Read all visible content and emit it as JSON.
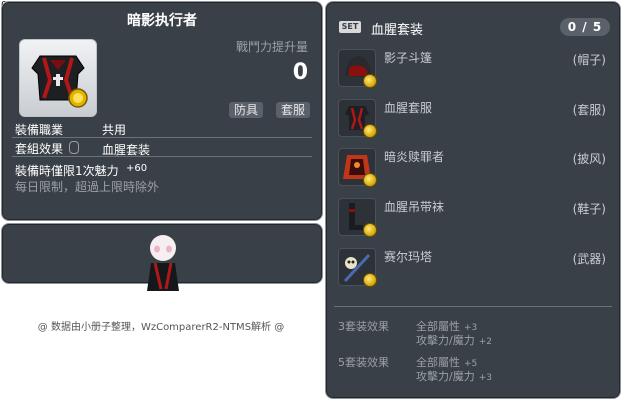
{
  "corner_id": "01052644",
  "item": {
    "title": "暗影执行者",
    "power_label": "戰鬥力提升量",
    "power_value": "0",
    "tags": [
      "防具",
      "套服"
    ],
    "job_label": "裝備職業",
    "job_value": "共用",
    "set_effect_label": "套組效果",
    "set_effect_value": "血腥套装",
    "time_limit_label": "裝備時僅限1次魅力",
    "time_limit_bonus": "+60",
    "daily_limit": "每日限制，超過上限時除外"
  },
  "footer": "@ 数据由小册子整理，WzComparerR2-NTMS解析 @",
  "set": {
    "badge": "SET",
    "name": "血腥套装",
    "count": "0 / 5",
    "items": [
      {
        "name": "影子斗篷",
        "slot": "(帽子)",
        "icon": "hood-icon"
      },
      {
        "name": "血腥套服",
        "slot": "(套服)",
        "icon": "robe-icon"
      },
      {
        "name": "暗炎赎罪者",
        "slot": "(披风)",
        "icon": "cape-icon"
      },
      {
        "name": "血腥吊带袜",
        "slot": "(鞋子)",
        "icon": "boots-icon"
      },
      {
        "name": "赛尔玛塔",
        "slot": "(武器)",
        "icon": "weapon-icon"
      }
    ],
    "effects": [
      {
        "title": "3套装效果",
        "lines": [
          {
            "text": "全部屬性",
            "value": "+3"
          },
          {
            "text": "攻擊力/魔力",
            "value": "+2"
          }
        ]
      },
      {
        "title": "5套装效果",
        "lines": [
          {
            "text": "全部屬性",
            "value": "+5"
          },
          {
            "text": "攻擊力/魔力",
            "value": "+3"
          }
        ]
      }
    ]
  },
  "colors": {
    "panel": "#3a4048",
    "border": "#8e949b",
    "text_dim": "#9aa0a6"
  }
}
